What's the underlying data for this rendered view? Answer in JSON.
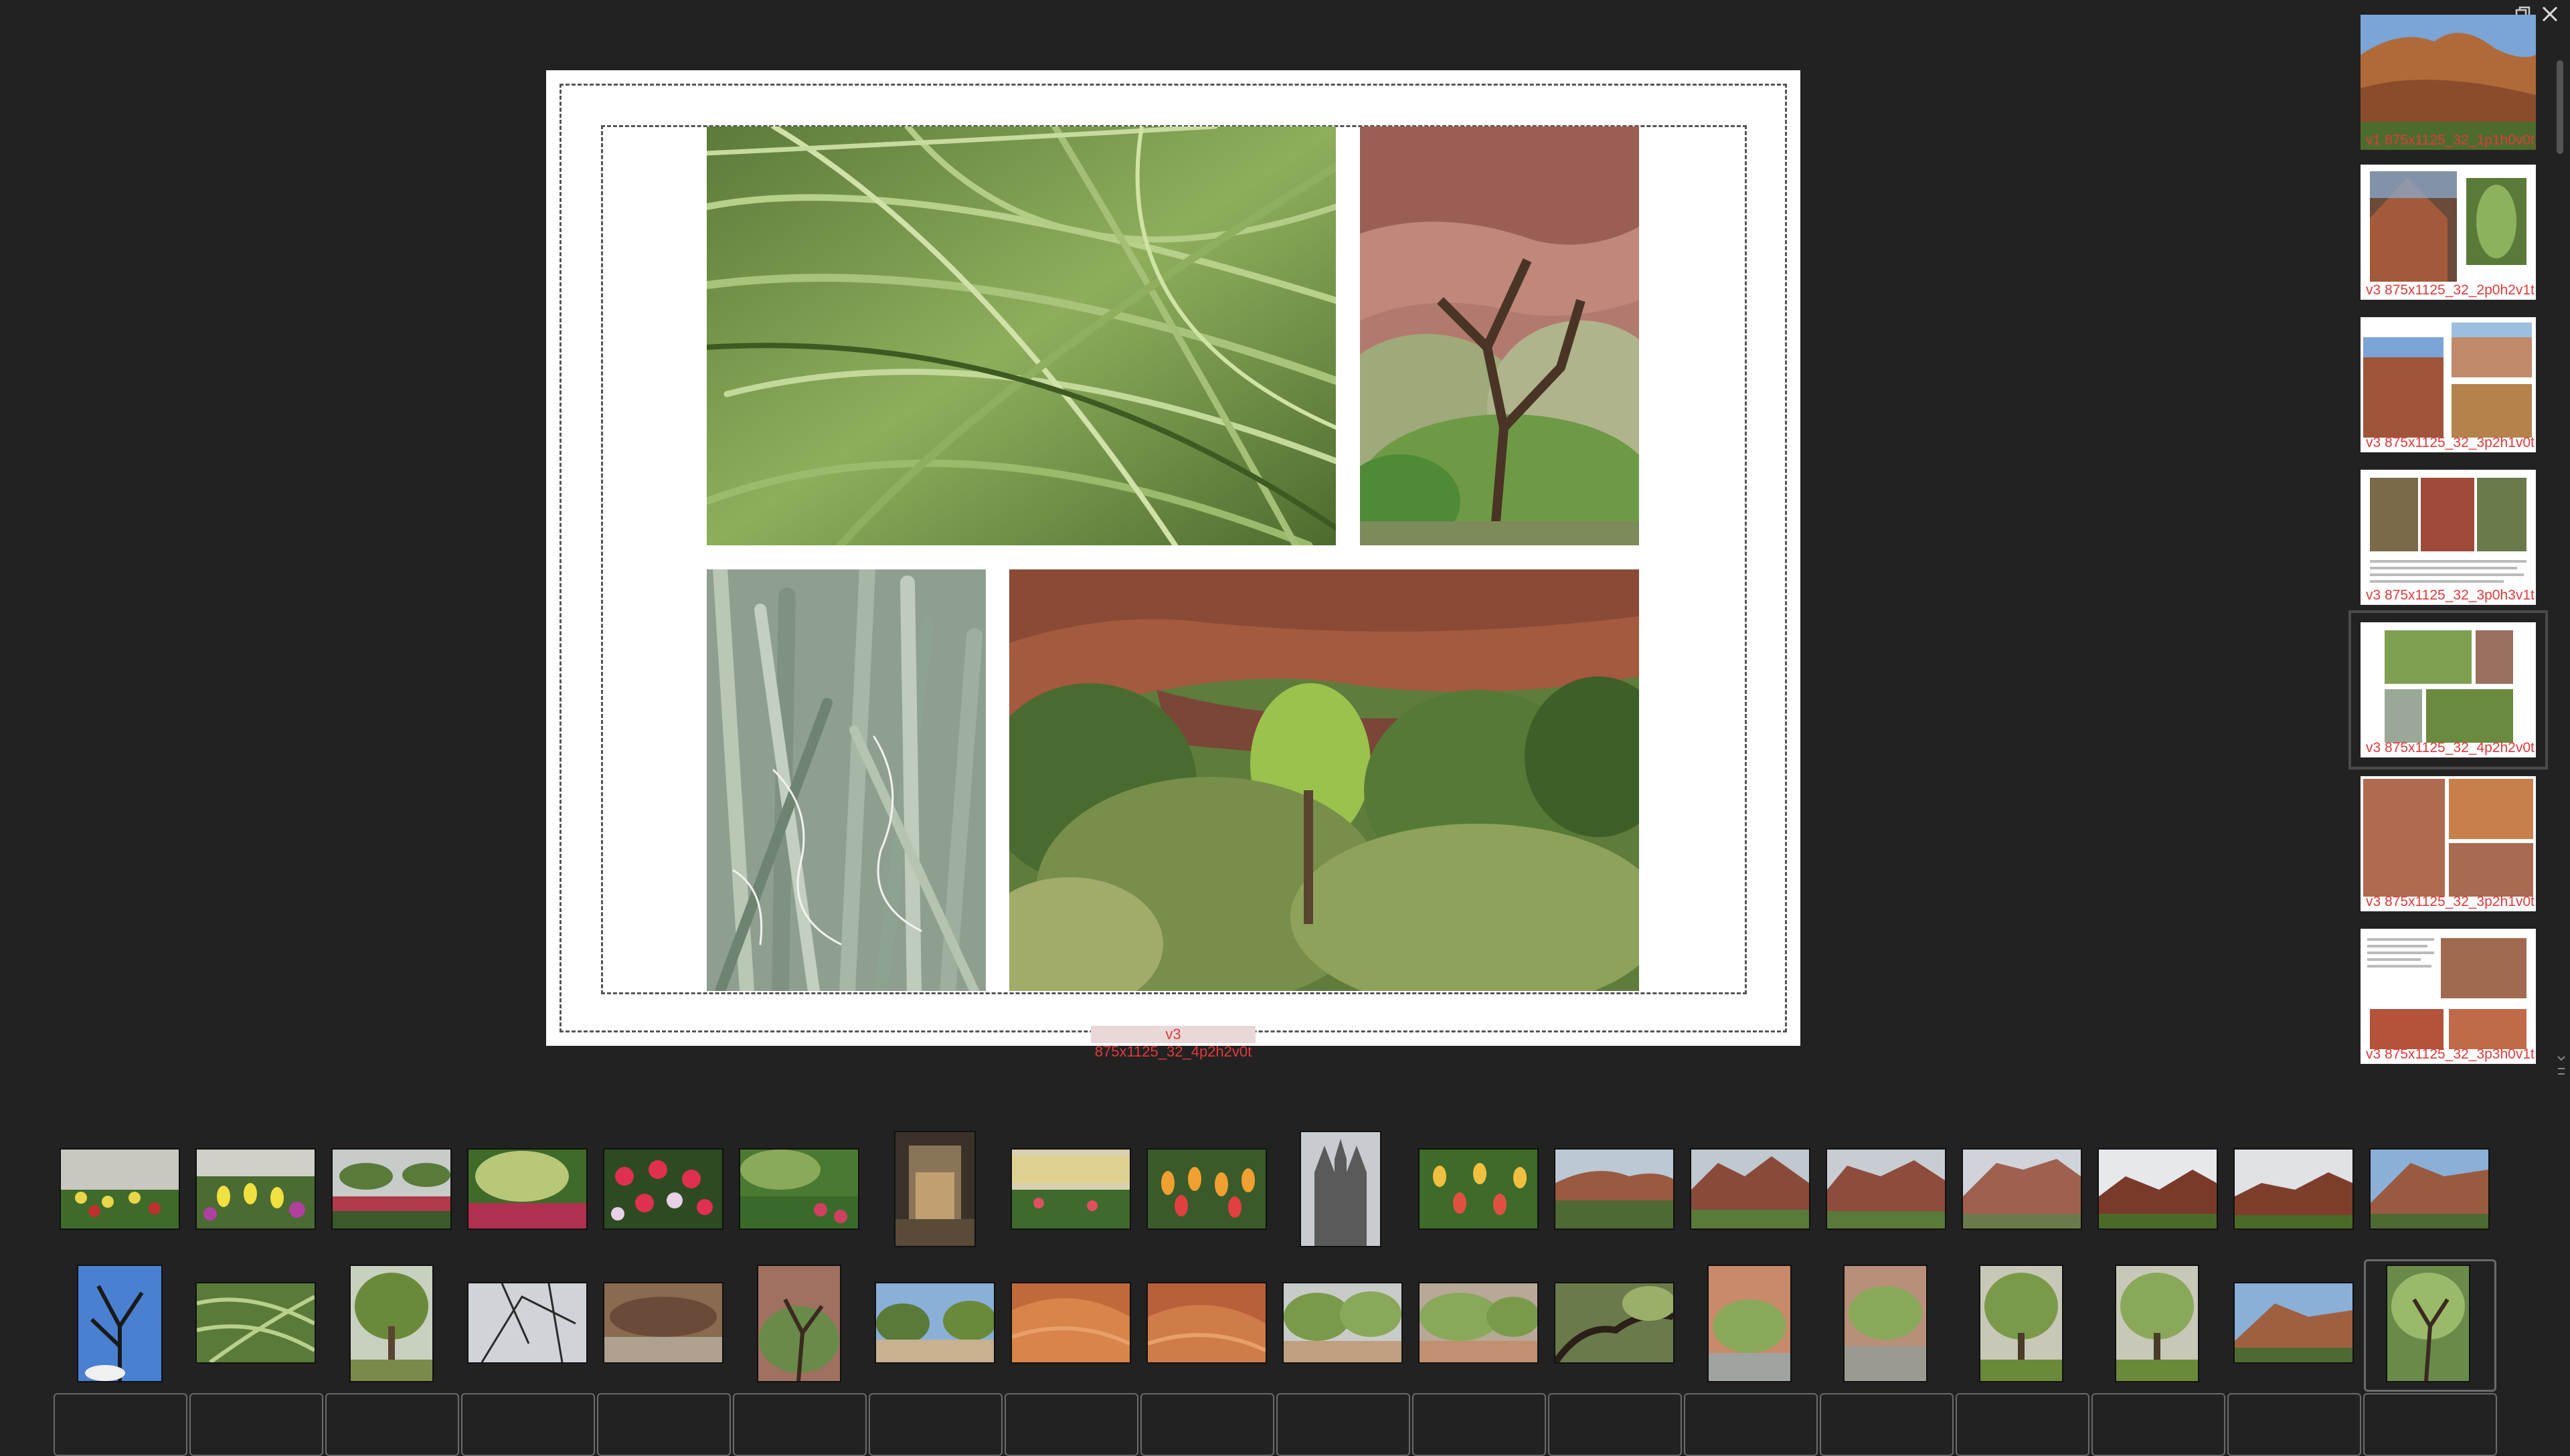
{
  "preview": {
    "caption": "v3 875x1125_32_4p2h2v0t"
  },
  "page_list": {
    "items": [
      {
        "caption": "v1 875x1125_32_1p1h0v0t_fr"
      },
      {
        "caption": "v3 875x1125_32_2p0h2v1t"
      },
      {
        "caption": "v3 875x1125_32_3p2h1v0t"
      },
      {
        "caption": "v3 875x1125_32_3p0h3v1t"
      },
      {
        "caption": "v3 875x1125_32_4p2h2v0t"
      },
      {
        "caption": "v3 875x1125_32_3p2h1v0t"
      },
      {
        "caption": "v3 875x1125_32_3p3h0v1t"
      }
    ],
    "selected_index": 4
  },
  "colors": {
    "background": "#222222",
    "caption_red": "#e03a3a",
    "selection_border": "#6a6a6a"
  }
}
